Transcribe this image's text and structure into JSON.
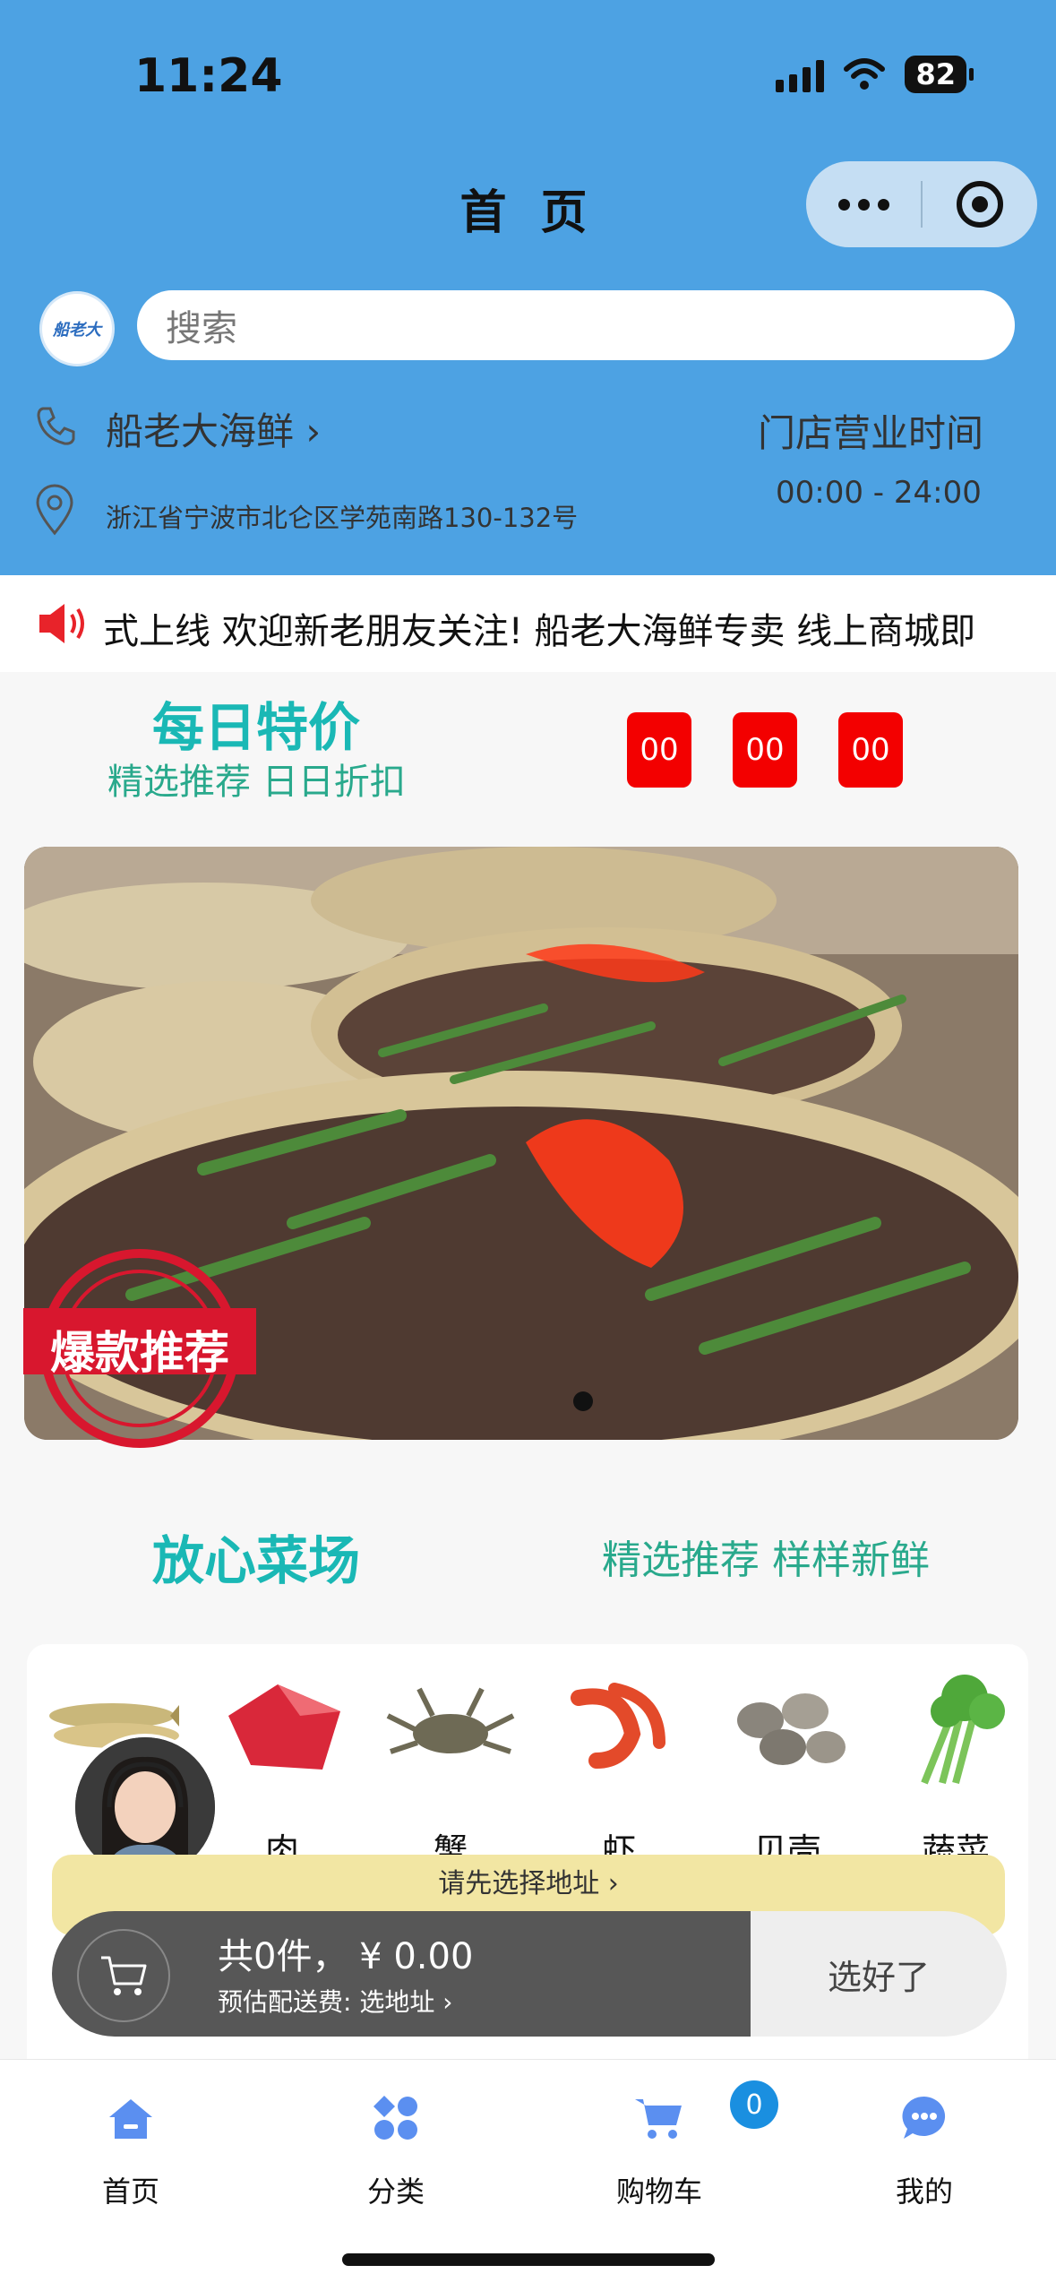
{
  "status_bar": {
    "time": "11:24",
    "battery": "82"
  },
  "header": {
    "title": "首 页"
  },
  "search": {
    "placeholder": "搜索",
    "logo_text": "船老大"
  },
  "store": {
    "name": "船老大海鲜 ›",
    "hours_label": "门店营业时间",
    "hours": "00:00 - 24:00",
    "address": "浙江省宁波市北仑区学苑南路130-132号"
  },
  "ticker": {
    "text": "式上线 欢迎新老朋友关注!   船老大海鲜专卖 线上商城即"
  },
  "daily_special": {
    "title": "每日特价",
    "subtitle": "精选推荐 日日折扣",
    "countdown": [
      "00",
      "00",
      "00"
    ]
  },
  "banner": {
    "badge_text": "爆款推荐"
  },
  "market": {
    "title": "放心菜场",
    "subtitle": "精选推荐 样样新鲜"
  },
  "categories": [
    {
      "label": "鱼"
    },
    {
      "label": "肉"
    },
    {
      "label": "蟹"
    },
    {
      "label": "虾"
    },
    {
      "label": "贝壳"
    },
    {
      "label": "蔬菜"
    }
  ],
  "address_prompt": "请先选择地址 ›",
  "cart": {
    "total": "共0件，  ¥ 0.00",
    "delivery_fee": "预估配送费: 选地址 ›",
    "checkout_label": "选好了"
  },
  "tabbar": {
    "home": "首页",
    "category": "分类",
    "cart": "购物车",
    "mine": "我的",
    "cart_count": "0"
  },
  "colors": {
    "header_bg": "#4da2e3",
    "accent_teal": "#1ab8b5",
    "countdown_red": "#f30000",
    "tab_blue": "#5b8ff0"
  }
}
